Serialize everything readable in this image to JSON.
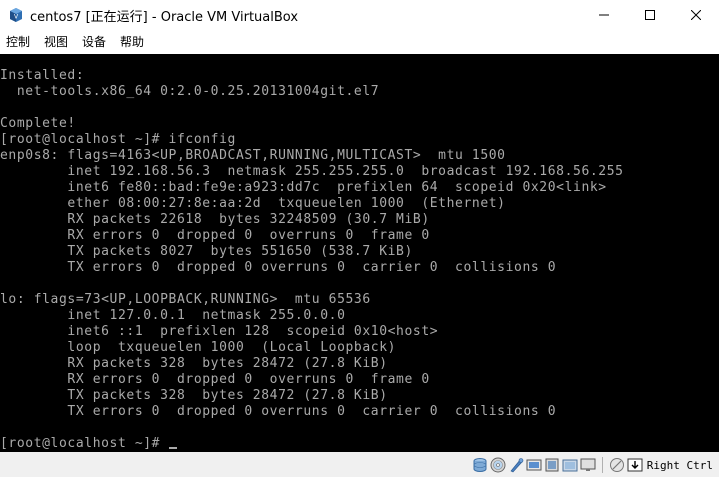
{
  "window": {
    "title": "centos7 [正在运行] - Oracle VM VirtualBox",
    "controls": [
      "minimize",
      "maximize",
      "close"
    ]
  },
  "menubar": {
    "items": [
      "控制",
      "视图",
      "设备",
      "帮助"
    ]
  },
  "console": {
    "lines": [
      "Installed:",
      "  net-tools.x86_64 0:2.0-0.25.20131004git.el7",
      "",
      "Complete!",
      "[root@localhost ~]# ifconfig",
      "enp0s8: flags=4163<UP,BROADCAST,RUNNING,MULTICAST>  mtu 1500",
      "        inet 192.168.56.3  netmask 255.255.255.0  broadcast 192.168.56.255",
      "        inet6 fe80::bad:fe9e:a923:dd7c  prefixlen 64  scopeid 0x20<link>",
      "        ether 08:00:27:8e:aa:2d  txqueuelen 1000  (Ethernet)",
      "        RX packets 22618  bytes 32248509 (30.7 MiB)",
      "        RX errors 0  dropped 0  overruns 0  frame 0",
      "        TX packets 8027  bytes 551650 (538.7 KiB)",
      "        TX errors 0  dropped 0 overruns 0  carrier 0  collisions 0",
      "",
      "lo: flags=73<UP,LOOPBACK,RUNNING>  mtu 65536",
      "        inet 127.0.0.1  netmask 255.0.0.0",
      "        inet6 ::1  prefixlen 128  scopeid 0x10<host>",
      "        loop  txqueuelen 1000  (Local Loopback)",
      "        RX packets 328  bytes 28472 (27.8 KiB)",
      "        RX errors 0  dropped 0  overruns 0  frame 0",
      "        TX packets 328  bytes 28472 (27.8 KiB)",
      "        TX errors 0  dropped 0 overruns 0  carrier 0  collisions 0",
      "",
      "[root@localhost ~]# "
    ],
    "foreground": "#aaaaaa",
    "background": "#000000"
  },
  "statusbar": {
    "icons": [
      "hard-disk-icon",
      "optical-drive-icon",
      "audio-icon",
      "network-icon",
      "usb-icon",
      "shared-folders-icon",
      "display-icon",
      "video-capture-icon",
      "mouse-integration-icon",
      "keyboard-capture-icon"
    ],
    "host_key": "Right Ctrl"
  }
}
